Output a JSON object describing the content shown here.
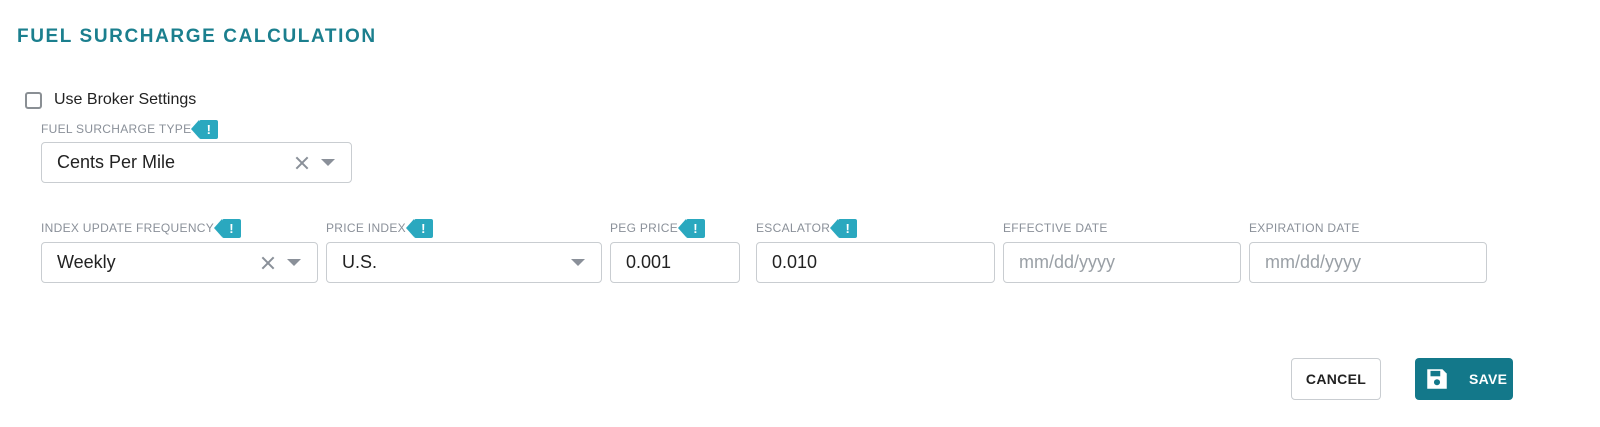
{
  "section": {
    "title": "FUEL SURCHARGE CALCULATION"
  },
  "broker": {
    "label": "Use Broker Settings",
    "checked": false
  },
  "surcharge_type": {
    "label": "FUEL SURCHARGE TYPE",
    "value": "Cents Per Mile"
  },
  "index_update_frequency": {
    "label": "INDEX UPDATE FREQUENCY",
    "value": "Weekly"
  },
  "price_index": {
    "label": "PRICE INDEX",
    "value": "U.S."
  },
  "peg_price": {
    "label": "PEG PRICE",
    "value": "0.001"
  },
  "escalator": {
    "label": "ESCALATOR",
    "value": "0.010"
  },
  "effective_date": {
    "label": "EFFECTIVE DATE",
    "placeholder": "mm/dd/yyyy"
  },
  "expiration_date": {
    "label": "EXPIRATION DATE",
    "placeholder": "mm/dd/yyyy"
  },
  "info_badge": {
    "glyph": "!",
    "color": "#2aa8bf"
  },
  "actions": {
    "cancel_label": "CANCEL",
    "save_label": "SAVE"
  },
  "colors": {
    "accent": "#1b7f8e",
    "save_bg": "#13788a"
  },
  "icons": {
    "save": "floppy-disk-icon",
    "clear": "close-icon",
    "dropdown": "chevron-down-icon",
    "info": "exclamation-icon"
  }
}
